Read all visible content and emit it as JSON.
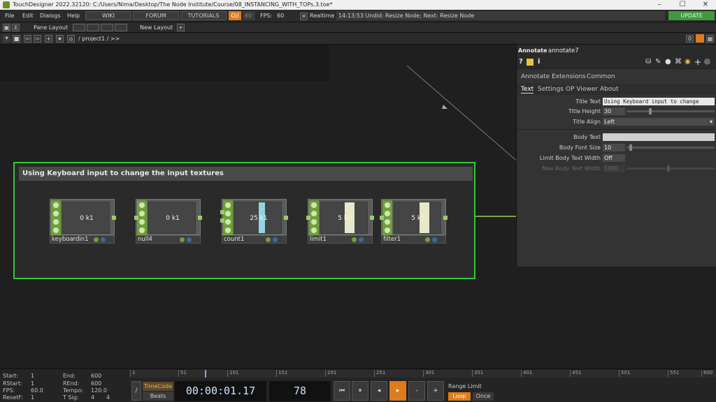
{
  "window": {
    "title": "TouchDesigner 2022.32120: C:/Users/Nima/Desktop/The Node Institute/Course/08_INSTANCING_WITH_TOPs.3.toe*",
    "minimize": "–",
    "maximize": "☐",
    "close": "✕"
  },
  "menu": {
    "items": [
      "File",
      "Edit",
      "Dialogs",
      "Help"
    ],
    "wiki": "WIKI",
    "forum": "FORUM",
    "tutorials": "TUTORIALS",
    "oi": "O|I",
    "fps_target": "60",
    "fps_label": "FPS:",
    "fps_value": "60",
    "realtime": "Realtime",
    "status": "14:13:53 Undid: Resize Node; Next: Resize Node",
    "update": "UPDATE"
  },
  "toolbar": {
    "pane_layout": "Pane Layout",
    "new_layout": "New Layout",
    "path": "/ project1 / >>",
    "right_num": "0"
  },
  "annotation": {
    "title": "Using Keyboard input to change the input textures"
  },
  "nodes": [
    {
      "name": "keyboardin1",
      "value": "0 k1"
    },
    {
      "name": "null4",
      "value": "0 k1"
    },
    {
      "name": "count1",
      "value": "25 k1"
    },
    {
      "name": "limit1",
      "value": "5 k1"
    },
    {
      "name": "filter1",
      "value": "5 k1"
    }
  ],
  "panel": {
    "op_type": "Annotate",
    "op_name": "annotate7",
    "tabs1": [
      "Annotate",
      "Extensions",
      "Common"
    ],
    "tabs2": [
      "Text",
      "Settings",
      "OP Viewer",
      "About"
    ],
    "params": {
      "title_text_label": "Title Text",
      "title_text_value": "Using Keyboard input to change",
      "title_height_label": "Title Height",
      "title_height_value": "30",
      "title_align_label": "Title Align",
      "title_align_value": "Left",
      "body_text_label": "Body Text",
      "body_text_value": "",
      "body_font_size_label": "Body Font Size",
      "body_font_size_value": "10",
      "limit_body_label": "Limit Body Text Width",
      "limit_body_value": "Off",
      "max_body_label": "Max Body Text Width",
      "max_body_value": "1000"
    }
  },
  "timeline": {
    "start_label": "Start:",
    "start": "1",
    "end_label": "End:",
    "end": "600",
    "rstart_label": "RStart:",
    "rstart": "1",
    "rend_label": "REnd:",
    "rend": "600",
    "fps_label": "FPS:",
    "fps": "60.0",
    "tempo_label": "Tempo:",
    "tempo": "120.0",
    "resetf_label": "ResetF:",
    "resetf": "1",
    "tsig_label": "T Sig:",
    "tsig_a": "4",
    "tsig_b": "4",
    "timecode": "TimeCode",
    "beats": "Beats",
    "time": "00:00:01.17",
    "frame": "78",
    "range_limit": "Range Limit",
    "loop": "Loop",
    "once": "Once",
    "ticks": [
      "1",
      "51",
      "101",
      "151",
      "201",
      "251",
      "301",
      "351",
      "401",
      "451",
      "501",
      "551",
      "600"
    ]
  }
}
